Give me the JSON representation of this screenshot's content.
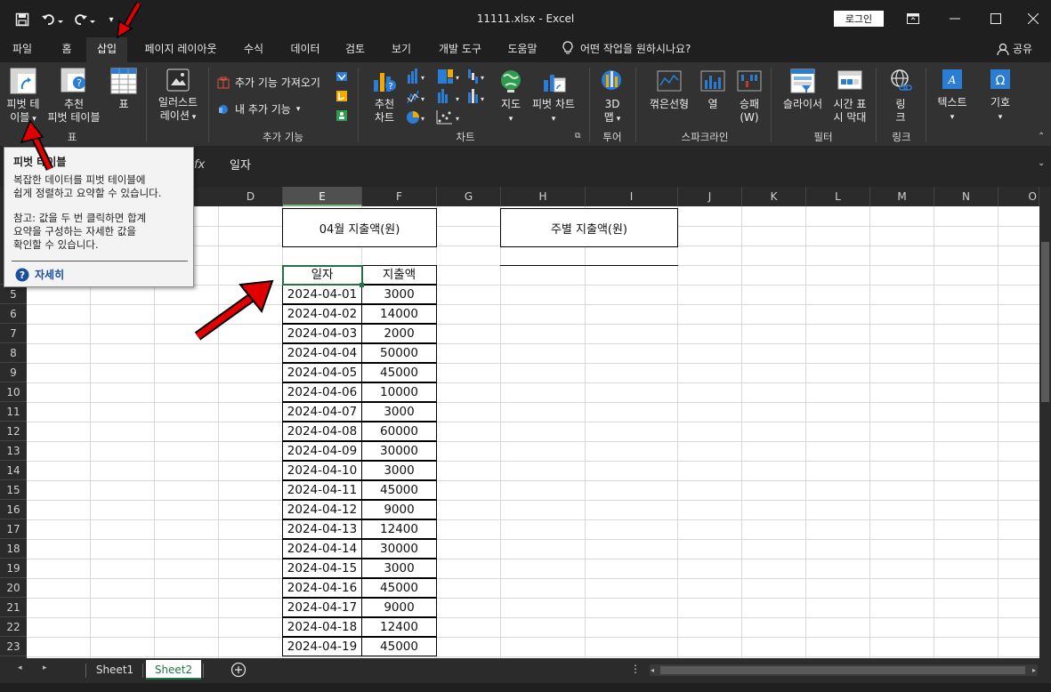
{
  "window": {
    "title": "11111.xlsx  -  Excel",
    "login_label": "로그인"
  },
  "menu": {
    "tabs": [
      "파일",
      "홈",
      "삽입",
      "페이지 레이아웃",
      "수식",
      "데이터",
      "검토",
      "보기",
      "개발 도구",
      "도움말"
    ],
    "active_tab": "삽입",
    "tell_me": "어떤 작업을 원하시나요?",
    "share": "공유"
  },
  "ribbon": {
    "pivot_line1": "피벗 테",
    "pivot_line2": "이블",
    "rec_pivot_line1": "추천",
    "rec_pivot_line2": "피벗 테이블",
    "table": "표",
    "illustrations_line1": "일러스트",
    "illustrations_line2": "레이션",
    "get_addins": "추가 기능 가져오기",
    "my_addins": "내 추가 기능",
    "rec_charts_line1": "추천",
    "rec_charts_line2": "차트",
    "maps": "지도",
    "pivot_chart": "피벗 차트",
    "map3d_line1": "3D",
    "map3d_line2": "맵",
    "spark_line": "꺾은선형",
    "spark_column": "열",
    "spark_winloss_line1": "승패",
    "spark_winloss_line2": "(W)",
    "slicer": "슬라이서",
    "timeline_line1": "시간 표",
    "timeline_line2": "시 막대",
    "link_line1": "링",
    "link_line2": "크",
    "text": "텍스트",
    "symbols": "기호",
    "groups": {
      "tables": "표",
      "addins": "추가 기능",
      "charts": "차트",
      "tours": "투어",
      "sparklines": "스파크라인",
      "filters": "필터",
      "links": "링크"
    }
  },
  "formula_bar": {
    "fx": "fx",
    "value": "일자"
  },
  "tooltip": {
    "title": "피벗 테이블",
    "body": "복잡한 데이터를 피벗 테이블에\n쉽게 정렬하고 요약할 수 있습니다.",
    "note": "참고: 값을 두 번 클릭하면 합계\n요약을 구성하는 자세한 값을\n확인할 수 있습니다.",
    "more": "자세히"
  },
  "sheet": {
    "columns": [
      "D",
      "E",
      "F",
      "G",
      "H",
      "I",
      "J",
      "K",
      "L",
      "M",
      "N",
      "O"
    ],
    "rows": [
      "5",
      "6",
      "7",
      "8",
      "9",
      "10",
      "11",
      "12",
      "13",
      "14",
      "15",
      "16",
      "17",
      "18",
      "19",
      "20",
      "21",
      "22",
      "23"
    ],
    "box_monthly": "04월 지출액(원)",
    "box_weekly": "주별 지출액(원)",
    "header_date": "일자",
    "header_amount": "지출액",
    "records": [
      {
        "date": "2024-04-01",
        "amount": "3000"
      },
      {
        "date": "2024-04-02",
        "amount": "14000"
      },
      {
        "date": "2024-04-03",
        "amount": "2000"
      },
      {
        "date": "2024-04-04",
        "amount": "50000"
      },
      {
        "date": "2024-04-05",
        "amount": "45000"
      },
      {
        "date": "2024-04-06",
        "amount": "10000"
      },
      {
        "date": "2024-04-07",
        "amount": "3000"
      },
      {
        "date": "2024-04-08",
        "amount": "60000"
      },
      {
        "date": "2024-04-09",
        "amount": "30000"
      },
      {
        "date": "2024-04-10",
        "amount": "3000"
      },
      {
        "date": "2024-04-11",
        "amount": "45000"
      },
      {
        "date": "2024-04-12",
        "amount": "9000"
      },
      {
        "date": "2024-04-13",
        "amount": "12400"
      },
      {
        "date": "2024-04-14",
        "amount": "30000"
      },
      {
        "date": "2024-04-15",
        "amount": "3000"
      },
      {
        "date": "2024-04-16",
        "amount": "45000"
      },
      {
        "date": "2024-04-17",
        "amount": "9000"
      },
      {
        "date": "2024-04-18",
        "amount": "12400"
      },
      {
        "date": "2024-04-19",
        "amount": "45000"
      }
    ]
  },
  "sheet_tabs": [
    "Sheet1",
    "Sheet2"
  ],
  "active_sheet": "Sheet2",
  "colors": {
    "accent": "#217346",
    "annotation_arrow": "#e00000"
  }
}
